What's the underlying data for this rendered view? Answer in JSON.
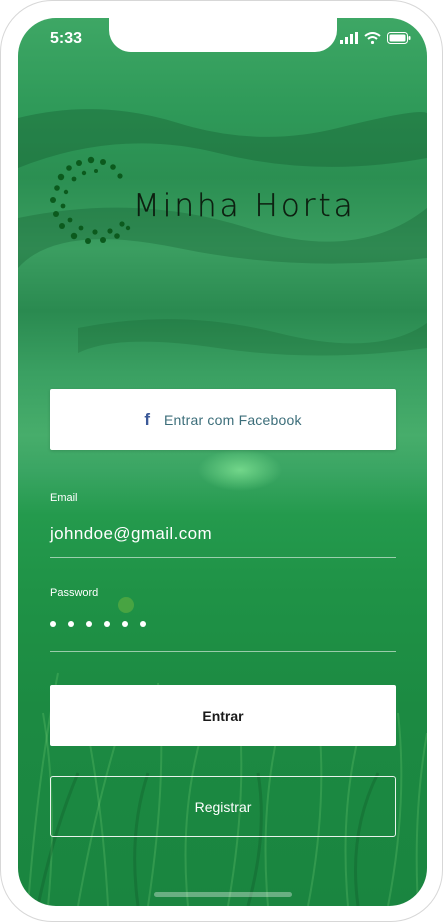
{
  "status_bar": {
    "time": "5:33"
  },
  "brand": {
    "name": "Minha Horta"
  },
  "facebook_button": {
    "label": "Entrar com Facebook",
    "icon": "facebook-icon"
  },
  "email": {
    "label": "Email",
    "value": "johndoe@gmail.com"
  },
  "password": {
    "label": "Password",
    "masked_length": 6
  },
  "login_button": {
    "label": "Entrar"
  },
  "register_button": {
    "label": "Registrar"
  },
  "colors": {
    "background_green": "#1f9246",
    "facebook_blue": "#3b5998",
    "logo_dots": "#0b5a1d"
  }
}
